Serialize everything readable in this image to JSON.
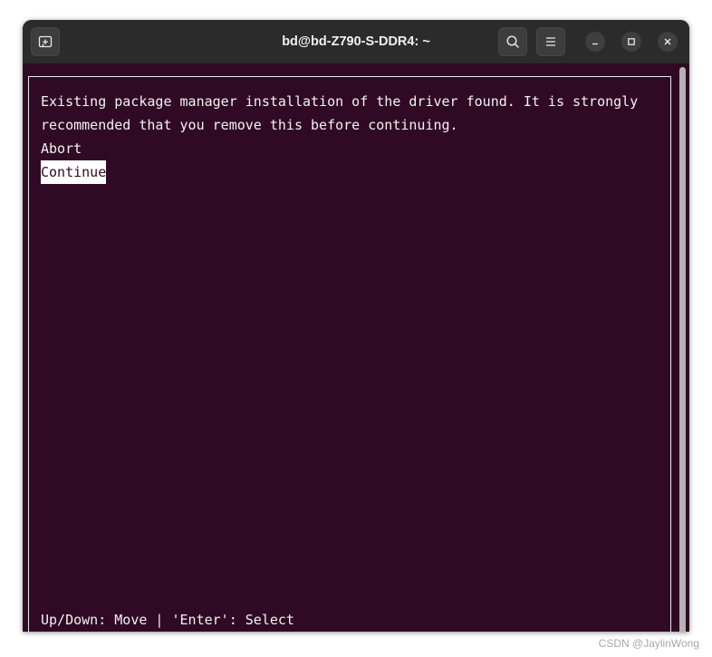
{
  "window": {
    "title": "bd@bd-Z790-S-DDR4: ~"
  },
  "titlebar": {
    "new_tab_icon": "new-tab-icon",
    "search_icon": "search-icon",
    "menu_icon": "hamburger-menu-icon",
    "minimize_icon": "minimize-icon",
    "maximize_icon": "maximize-icon",
    "close_icon": "close-icon"
  },
  "terminal": {
    "message_line1": "Existing package manager installation of the driver found. It is strongly",
    "message_line2": "recommended that you remove this before continuing.",
    "options": [
      {
        "label": "Abort",
        "selected": false
      },
      {
        "label": "Continue",
        "selected": true
      }
    ],
    "footer_hint": "Up/Down: Move | 'Enter': Select"
  },
  "colors": {
    "terminal_bg": "#300a24",
    "titlebar_bg": "#2b2b2b",
    "text": "#f2f2f2",
    "selected_bg": "#ffffff"
  },
  "watermark": "CSDN @JaylinWong"
}
